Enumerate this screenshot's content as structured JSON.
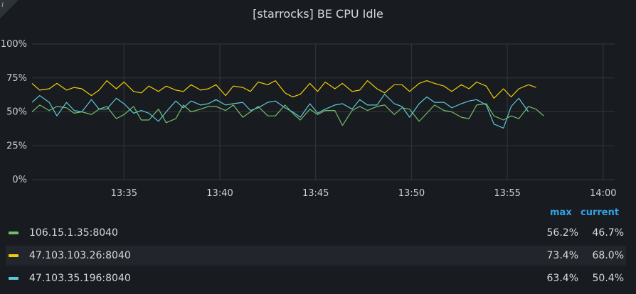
{
  "panel": {
    "title": "[starrocks] BE CPU Idle",
    "info_icon": "i"
  },
  "legend": {
    "headers": {
      "max": "max",
      "current": "current"
    },
    "rows": [
      {
        "name": "106.15.1.35:8040",
        "color": "#73bf69",
        "max": "56.2%",
        "current": "46.7%"
      },
      {
        "name": "47.103.103.26:8040",
        "color": "#f2cc0c",
        "max": "73.4%",
        "current": "68.0%"
      },
      {
        "name": "47.103.35.196:8040",
        "color": "#5ec8d8",
        "max": "63.4%",
        "current": "50.4%"
      }
    ]
  },
  "colors": {
    "grid": "#33373d",
    "accent": "#33a2e5",
    "background": "#181b1f"
  },
  "chart_data": {
    "type": "line",
    "title": "[starrocks] BE CPU Idle",
    "y_ticks": [
      "0%",
      "25%",
      "50%",
      "75%",
      "100%"
    ],
    "ylim": [
      0,
      100
    ],
    "x_ticks": [
      "13:35",
      "13:40",
      "13:45",
      "13:50",
      "13:55",
      "14:00"
    ],
    "x_tick_minutes": [
      35,
      40,
      45,
      50,
      55,
      60
    ],
    "xlim_minutes": [
      30.2,
      60.6
    ],
    "legend_position": "bottom",
    "grid": true,
    "x_minutes": [
      30.2,
      30.6,
      31.1,
      31.5,
      32.0,
      32.4,
      32.8,
      33.3,
      33.7,
      34.1,
      34.6,
      35.0,
      35.5,
      35.9,
      36.3,
      36.8,
      37.2,
      37.7,
      38.1,
      38.5,
      39.0,
      39.4,
      39.8,
      40.3,
      40.7,
      41.2,
      41.6,
      42.0,
      42.5,
      42.9,
      43.4,
      43.8,
      44.2,
      44.7,
      45.1,
      45.5,
      46.0,
      46.4,
      46.9,
      47.3,
      47.7,
      48.2,
      48.6,
      49.1,
      49.5,
      49.9,
      50.4,
      50.8,
      51.2,
      51.7,
      52.1,
      52.6,
      53.0,
      53.4,
      53.9,
      54.3,
      54.8,
      55.2,
      55.6,
      56.1,
      56.5,
      56.9,
      57.4,
      57.8,
      58.3,
      58.7,
      59.1,
      59.6,
      60.0,
      60.4
    ],
    "series": [
      {
        "name": "106.15.1.35:8040",
        "color": "#73bf69",
        "values": [
          50,
          55,
          51,
          54,
          53,
          49,
          50,
          48,
          52,
          54,
          45,
          48,
          54,
          44,
          44,
          52,
          42,
          45,
          55,
          50,
          52,
          54,
          54,
          51,
          55,
          46,
          50,
          54,
          47,
          47,
          55,
          49,
          44,
          52,
          48,
          51,
          51,
          40,
          51,
          54,
          51,
          54,
          55,
          48,
          53,
          52,
          43,
          49,
          55,
          51,
          50,
          46,
          45,
          55,
          56,
          47,
          44,
          47,
          45,
          54,
          52,
          47
        ]
      },
      {
        "name": "47.103.103.26:8040",
        "color": "#f2cc0c",
        "values": [
          71,
          66,
          67,
          71,
          66,
          68,
          67,
          62,
          66,
          73,
          67,
          72,
          65,
          64,
          69,
          65,
          69,
          66,
          65,
          70,
          66,
          67,
          70,
          62,
          69,
          68,
          65,
          72,
          70,
          73,
          64,
          61,
          63,
          71,
          65,
          72,
          67,
          71,
          65,
          66,
          73,
          67,
          64,
          70,
          70,
          65,
          71,
          73,
          71,
          69,
          65,
          70,
          67,
          72,
          69,
          60,
          67,
          61,
          67,
          70,
          68
        ]
      },
      {
        "name": "47.103.35.196:8040",
        "color": "#5ec8d8",
        "values": [
          57,
          62,
          57,
          47,
          57,
          51,
          50,
          59,
          52,
          52,
          60,
          56,
          49,
          51,
          49,
          43,
          50,
          58,
          53,
          58,
          55,
          56,
          59,
          55,
          56,
          57,
          51,
          53,
          57,
          58,
          53,
          50,
          46,
          56,
          49,
          52,
          55,
          56,
          52,
          59,
          55,
          55,
          63,
          56,
          54,
          46,
          56,
          61,
          57,
          57,
          53,
          56,
          58,
          59,
          55,
          41,
          38,
          54,
          60,
          50
        ]
      }
    ]
  }
}
